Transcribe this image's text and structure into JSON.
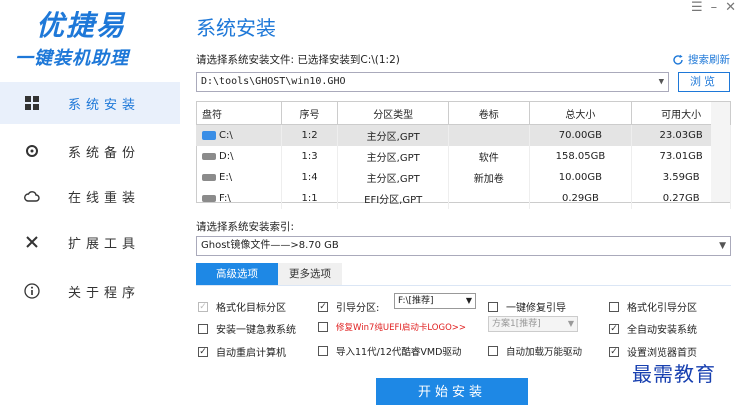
{
  "brand": {
    "line1": "优捷易",
    "line2": "一键装机助理"
  },
  "sidebar": {
    "items": [
      {
        "label": "系统安装",
        "icon": "windows-icon"
      },
      {
        "label": "系统备份",
        "icon": "backup-icon"
      },
      {
        "label": "在线重装",
        "icon": "cloud-icon"
      },
      {
        "label": "扩展工具",
        "icon": "tools-icon"
      },
      {
        "label": "关于程序",
        "icon": "info-icon"
      }
    ]
  },
  "window": {
    "menu": "☰",
    "minimize": "–",
    "close": "✕"
  },
  "header": {
    "title": "系统安装"
  },
  "install": {
    "file_label": "请选择系统安装文件: 已选择安装到C:\\(1:2)",
    "refresh_label": "搜索刷新",
    "path_value": "D:\\tools\\GHOST\\win10.GHO",
    "browse_label": "浏览"
  },
  "table": {
    "columns": [
      "盘符",
      "序号",
      "分区类型",
      "卷标",
      "总大小",
      "可用大小"
    ],
    "rows": [
      {
        "drive": "C:\\",
        "index": "1:2",
        "type": "主分区,GPT",
        "label": "",
        "total": "70.00GB",
        "free": "23.03GB"
      },
      {
        "drive": "D:\\",
        "index": "1:3",
        "type": "主分区,GPT",
        "label": "软件",
        "total": "158.05GB",
        "free": "73.01GB"
      },
      {
        "drive": "E:\\",
        "index": "1:4",
        "type": "主分区,GPT",
        "label": "新加卷",
        "total": "10.00GB",
        "free": "3.59GB"
      },
      {
        "drive": "F:\\",
        "index": "1:1",
        "type": "EFI分区,GPT",
        "label": "",
        "total": "0.29GB",
        "free": "0.27GB"
      }
    ]
  },
  "index": {
    "label": "请选择系统安装索引:",
    "value": "Ghost镜像文件——>8.70 GB"
  },
  "tabs": {
    "advanced": "高级选项",
    "more": "更多选项"
  },
  "options": {
    "format_target": {
      "label": "格式化目标分区",
      "checked": true,
      "disabled": true
    },
    "boot_partition": {
      "label": "引导分区:",
      "checked": true,
      "select": "F:\\[推荐]"
    },
    "repair_boot": {
      "label": "一键修复引导",
      "checked": false
    },
    "format_boot": {
      "label": "格式化引导分区",
      "checked": false
    },
    "rescue_system": {
      "label": "安装一键急救系统",
      "checked": false
    },
    "fix_logo": {
      "label": "修复Win7纯UEFI启动卡LOGO>>",
      "checked": false,
      "select": "方案1[推荐]"
    },
    "auto_install": {
      "label": "全自动安装系统",
      "checked": true
    },
    "auto_restart": {
      "label": "自动重启计算机",
      "checked": true
    },
    "vmd_driver": {
      "label": "导入11代/12代酷睿VMD驱动",
      "checked": false
    },
    "universal_driver": {
      "label": "自动加载万能驱动",
      "checked": false
    },
    "browser_home": {
      "label": "设置浏览器首页",
      "checked": true
    }
  },
  "start_button": "开始安装",
  "watermark": "最需教育"
}
